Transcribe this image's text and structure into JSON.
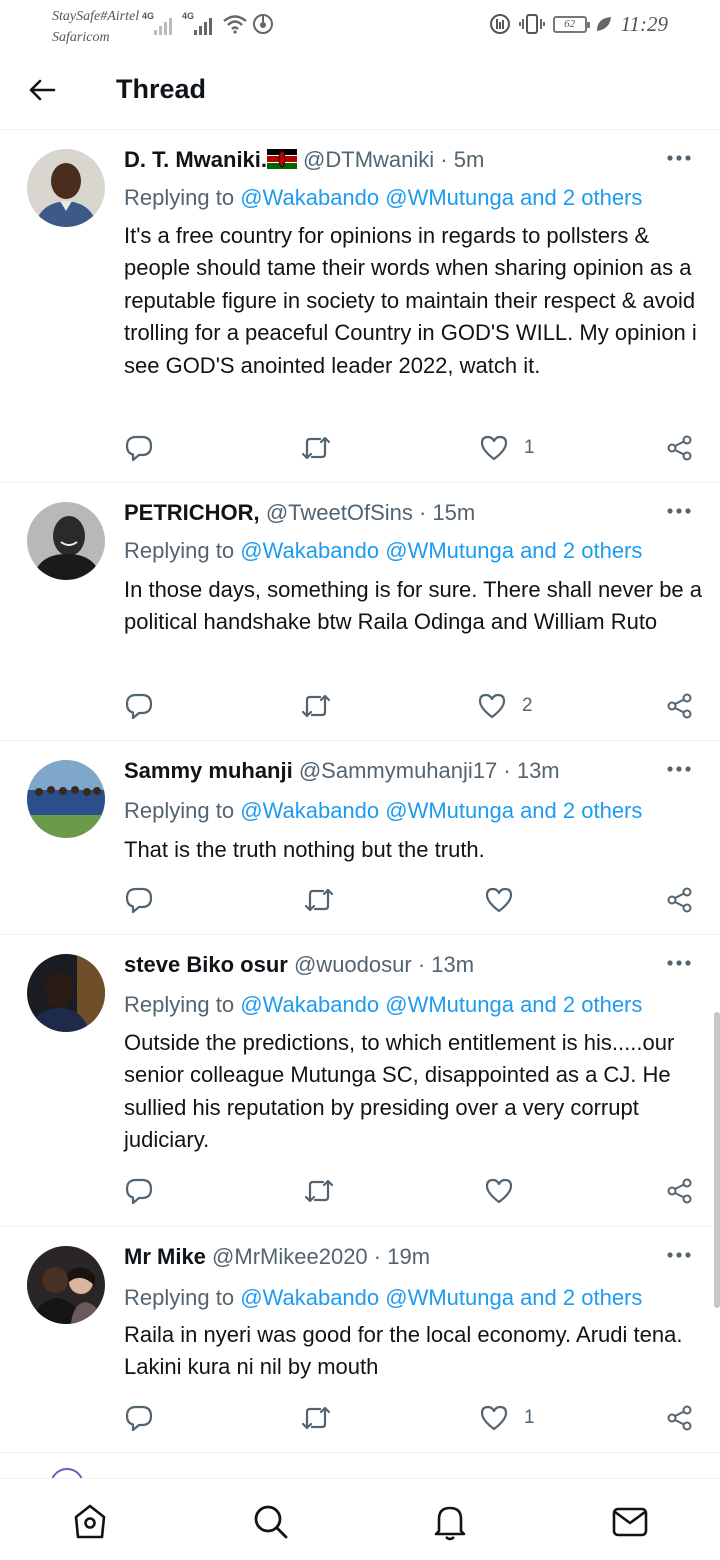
{
  "status_bar": {
    "carrier_line1": "StaySafe#Airtel",
    "carrier_line2": "Safaricom",
    "network1": "4G",
    "network2": "4G",
    "battery": "62",
    "time": "11:29"
  },
  "header": {
    "title": "Thread"
  },
  "tweets": [
    {
      "name": "D. T. Mwaniki.",
      "handle": "@DTMwaniki",
      "time": "· 5m",
      "reply_prefix": "Replying to",
      "reply_users": "@Wakabando @WMutunga and 2 others",
      "text": "It's a free country for opinions in regards to pollsters & people should tame their words when sharing opinion as a reputable figure in society to maintain their respect & avoid trolling for a peaceful Country in GOD'S WILL. My opinion i see GOD'S anointed leader 2022, watch it.",
      "likes": "1"
    },
    {
      "name": "PETRICHOR,",
      "handle": "@TweetOfSins",
      "time": "· 15m",
      "reply_prefix": "Replying to",
      "reply_users": "@Wakabando @WMutunga and 2 others",
      "text": "In those days, something is for sure. There shall never be a political handshake btw Raila Odinga and William Ruto",
      "likes": "2"
    },
    {
      "name": "Sammy muhanji",
      "handle": "@Sammymuhanji17",
      "time": "· 13m",
      "reply_prefix": "Replying to",
      "reply_users": "@Wakabando @WMutunga and 2 others",
      "text": "That is the truth nothing but the truth.",
      "likes": ""
    },
    {
      "name": "steve Biko osur",
      "handle": "@wuodosur",
      "time": "· 13m",
      "reply_prefix": "Replying to",
      "reply_users": "@Wakabando @WMutunga and 2 others",
      "text": "Outside the predictions, to which entitlement is his.....our senior colleague Mutunga SC, disappointed as a CJ. He sullied his reputation by presiding over a very corrupt judiciary.",
      "likes": ""
    },
    {
      "name": "Mr Mike",
      "handle": "@MrMikee2020",
      "time": "· 19m",
      "reply_prefix": "Replying to",
      "reply_users": "@Wakabando @WMutunga and 2 others",
      "text": "Raila in nyeri was good for the local economy. Arudi tena. Lakini kura ni nil by mouth",
      "likes": "1"
    }
  ],
  "colors": {
    "link": "#1d9bf0",
    "secondary_text": "#536471",
    "primary_text": "#0f1419"
  },
  "bottom_nav": {
    "items": [
      "home-icon",
      "search-icon",
      "notifications-icon",
      "messages-icon"
    ]
  }
}
